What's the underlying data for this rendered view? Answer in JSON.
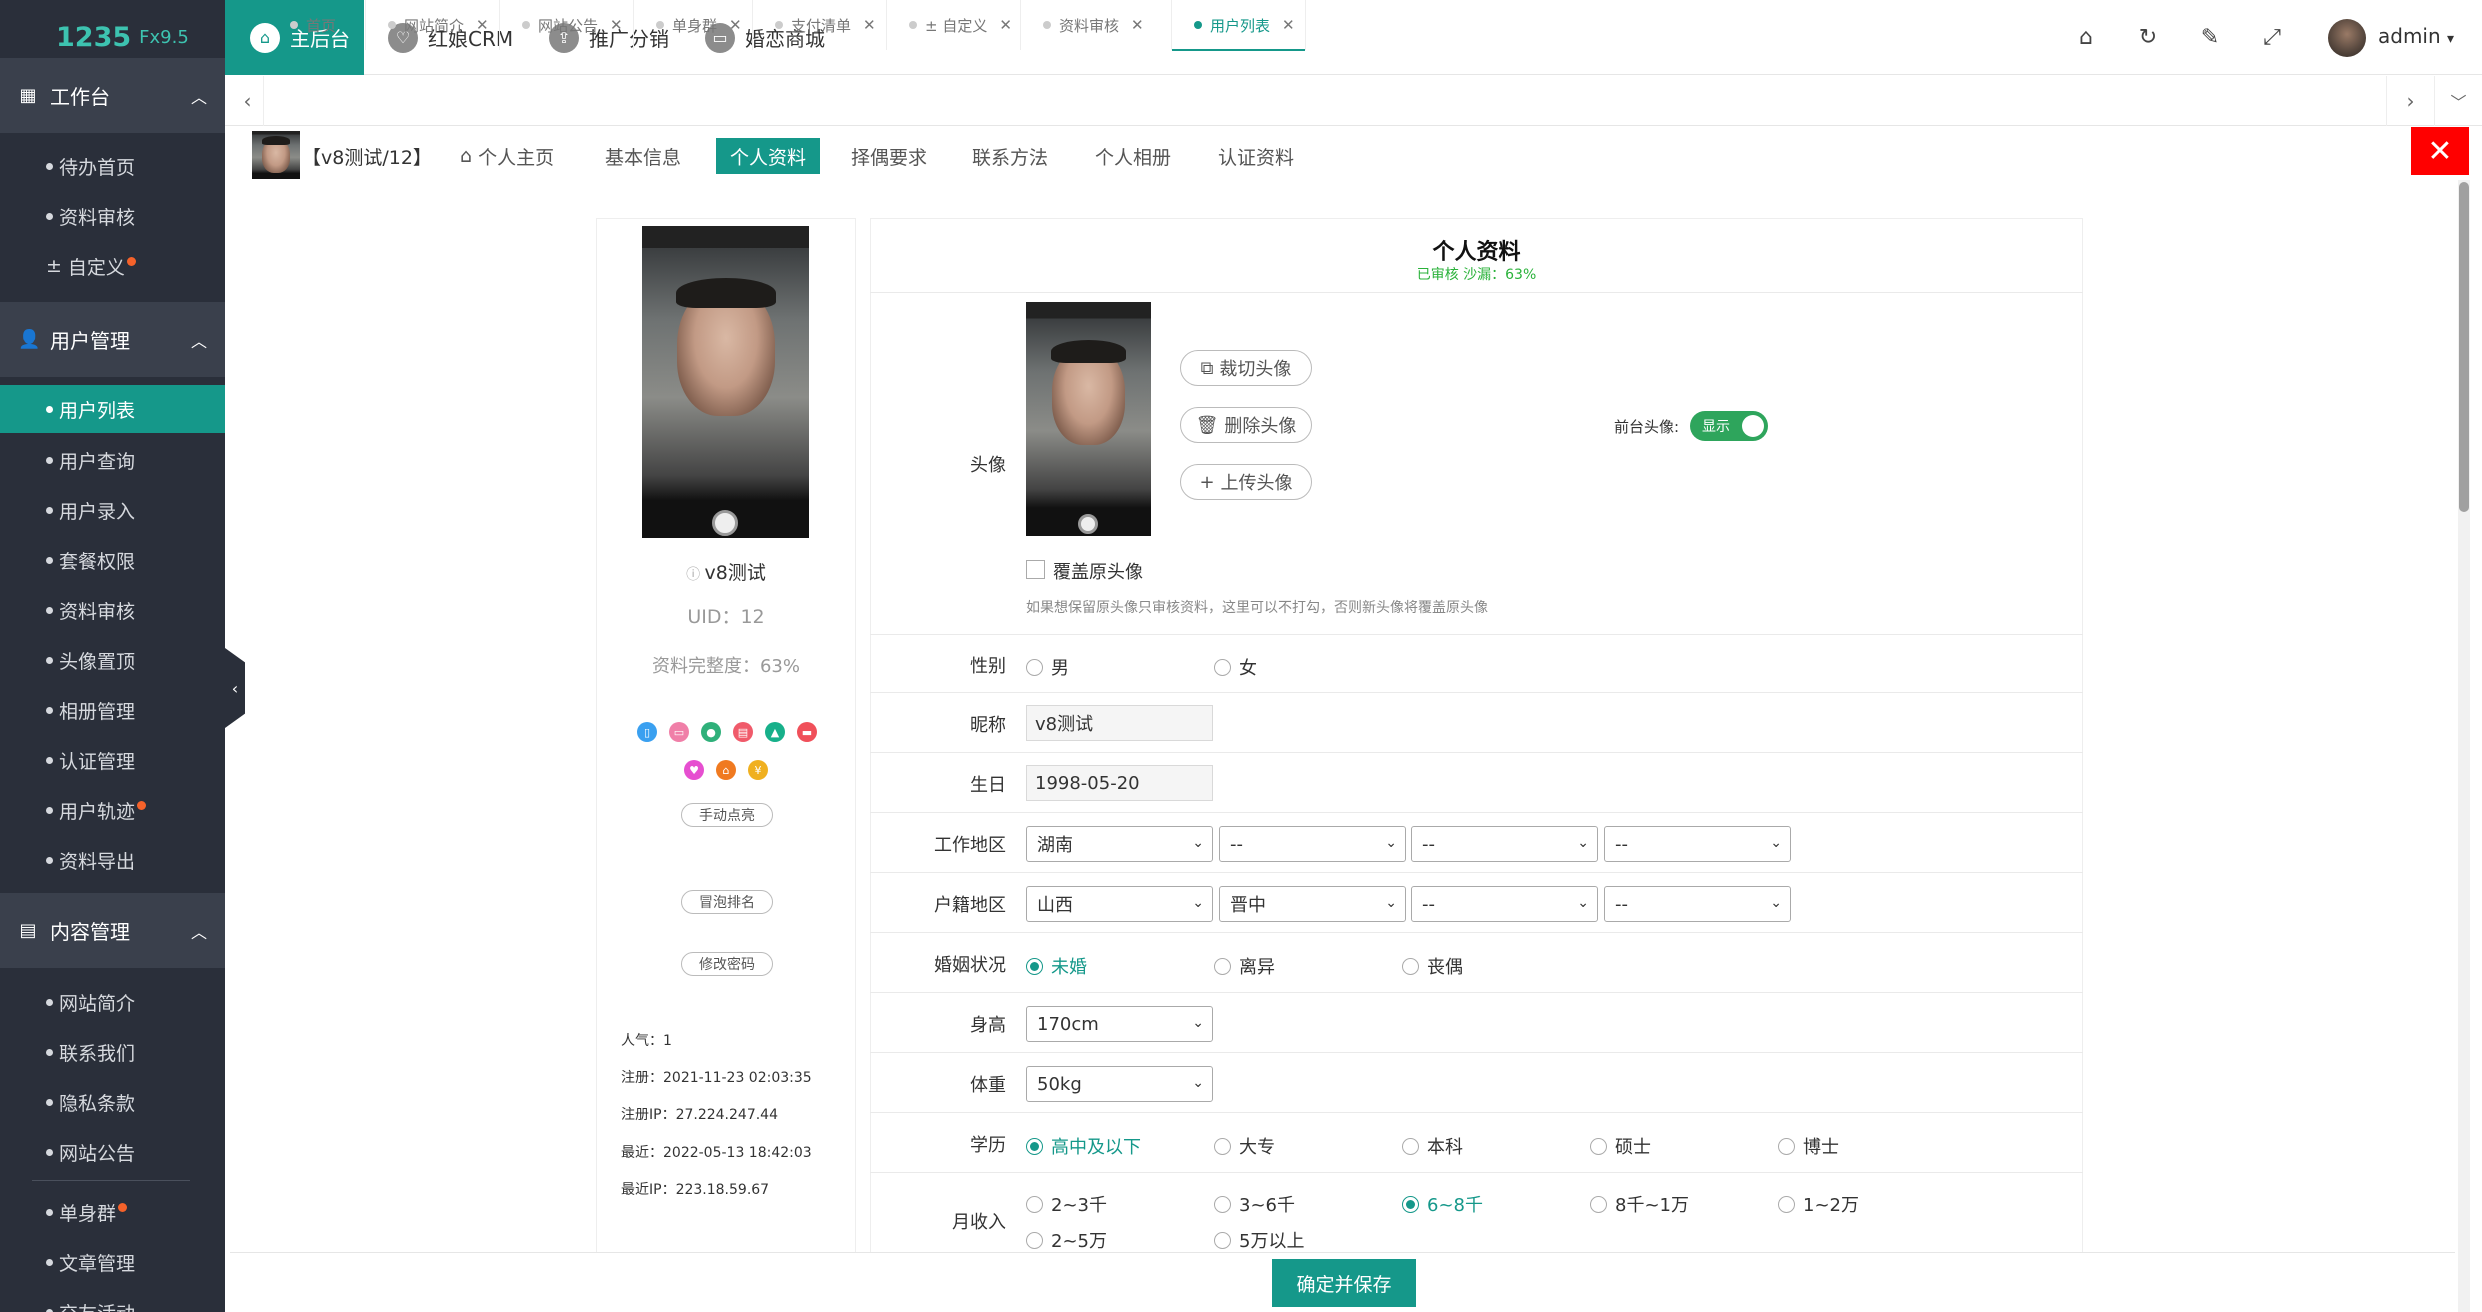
{
  "app": {
    "logo": "1235",
    "version": "Fx9.5",
    "user": "admin"
  },
  "topnav": [
    {
      "label": "主后台",
      "icon": "home-icon"
    },
    {
      "label": "红娘CRM",
      "icon": "heart-icon"
    },
    {
      "label": "推广分销",
      "icon": "share-icon"
    },
    {
      "label": "婚恋商城",
      "icon": "shop-icon"
    }
  ],
  "sidebar": {
    "sections": [
      {
        "title": "工作台",
        "items": [
          "待办首页",
          "资料审核",
          "自定义"
        ]
      },
      {
        "title": "用户管理",
        "items": [
          "用户列表",
          "用户查询",
          "用户录入",
          "套餐权限",
          "资料审核",
          "头像置顶",
          "相册管理",
          "认证管理",
          "用户轨迹",
          "资料导出"
        ]
      },
      {
        "title": "内容管理",
        "items": [
          "网站简介",
          "联系我们",
          "隐私条款",
          "网站公告",
          "单身群",
          "文章管理",
          "交友活动"
        ]
      }
    ],
    "active_item": "用户列表"
  },
  "tabs": [
    {
      "label": "首页"
    },
    {
      "label": "网站简介"
    },
    {
      "label": "网站公告"
    },
    {
      "label": "单身群"
    },
    {
      "label": "支付清单"
    },
    {
      "label": "± 自定义"
    },
    {
      "label": "资料审核"
    },
    {
      "label": "用户列表"
    }
  ],
  "profile_nav": {
    "user_tag": "【v8测试/12】",
    "items": [
      "个人主页",
      "基本信息",
      "个人资料",
      "择偶要求",
      "联系方法",
      "个人相册",
      "认证资料"
    ],
    "active": "个人资料",
    "close": "✕"
  },
  "user_card": {
    "nickname": "v8测试",
    "uid": "UID：12",
    "completeness": "资料完整度：63%",
    "btn_light": "手动点亮",
    "btn_rank": "冒泡排名",
    "btn_password": "修改密码",
    "stats": [
      "人气：1",
      "注册：2021-11-23 02:03:35",
      "注册IP：27.224.247.44",
      "最近：2022-05-13 18:42:03",
      "最近IP：223.18.59.67"
    ],
    "icon_colors": [
      "#3aa0f0",
      "#f07fa8",
      "#2fb07a",
      "#f05a6a",
      "#17b08a",
      "#f0505a",
      "#e64fd0",
      "#f07a20",
      "#f0b020"
    ]
  },
  "form": {
    "title": "个人资料",
    "subtitle": "已审核  沙漏：63%",
    "avatar": {
      "label": "头像",
      "crop": "裁切头像",
      "delete": "删除头像",
      "upload": "上传头像",
      "front_label": "前台头像:",
      "front_toggle": "显示",
      "cover_label": "覆盖原头像",
      "hint": "如果想保留原头像只审核资料，这里可以不打勾，否则新头像将覆盖原头像"
    },
    "gender": {
      "label": "性别",
      "options": [
        "男",
        "女"
      ],
      "selected": null
    },
    "nickname": {
      "label": "昵称",
      "value": "v8测试"
    },
    "birthday": {
      "label": "生日",
      "value": "1998-05-20"
    },
    "work_area": {
      "label": "工作地区",
      "values": [
        "湖南",
        "--",
        "--",
        "--"
      ]
    },
    "hukou": {
      "label": "户籍地区",
      "values": [
        "山西",
        "晋中",
        "--",
        "--"
      ]
    },
    "marriage": {
      "label": "婚姻状况",
      "options": [
        "未婚",
        "离异",
        "丧偶"
      ],
      "selected": "未婚"
    },
    "height": {
      "label": "身高",
      "value": "170cm"
    },
    "weight": {
      "label": "体重",
      "value": "50kg"
    },
    "education": {
      "label": "学历",
      "options": [
        "高中及以下",
        "大专",
        "本科",
        "硕士",
        "博士"
      ],
      "selected": "高中及以下"
    },
    "income": {
      "label": "月收入",
      "options": [
        "2~3千",
        "3~6千",
        "6~8千",
        "8千~1万",
        "1~2万",
        "2~5万",
        "5万以上"
      ],
      "selected": "6~8千"
    },
    "save": "确定并保存"
  }
}
